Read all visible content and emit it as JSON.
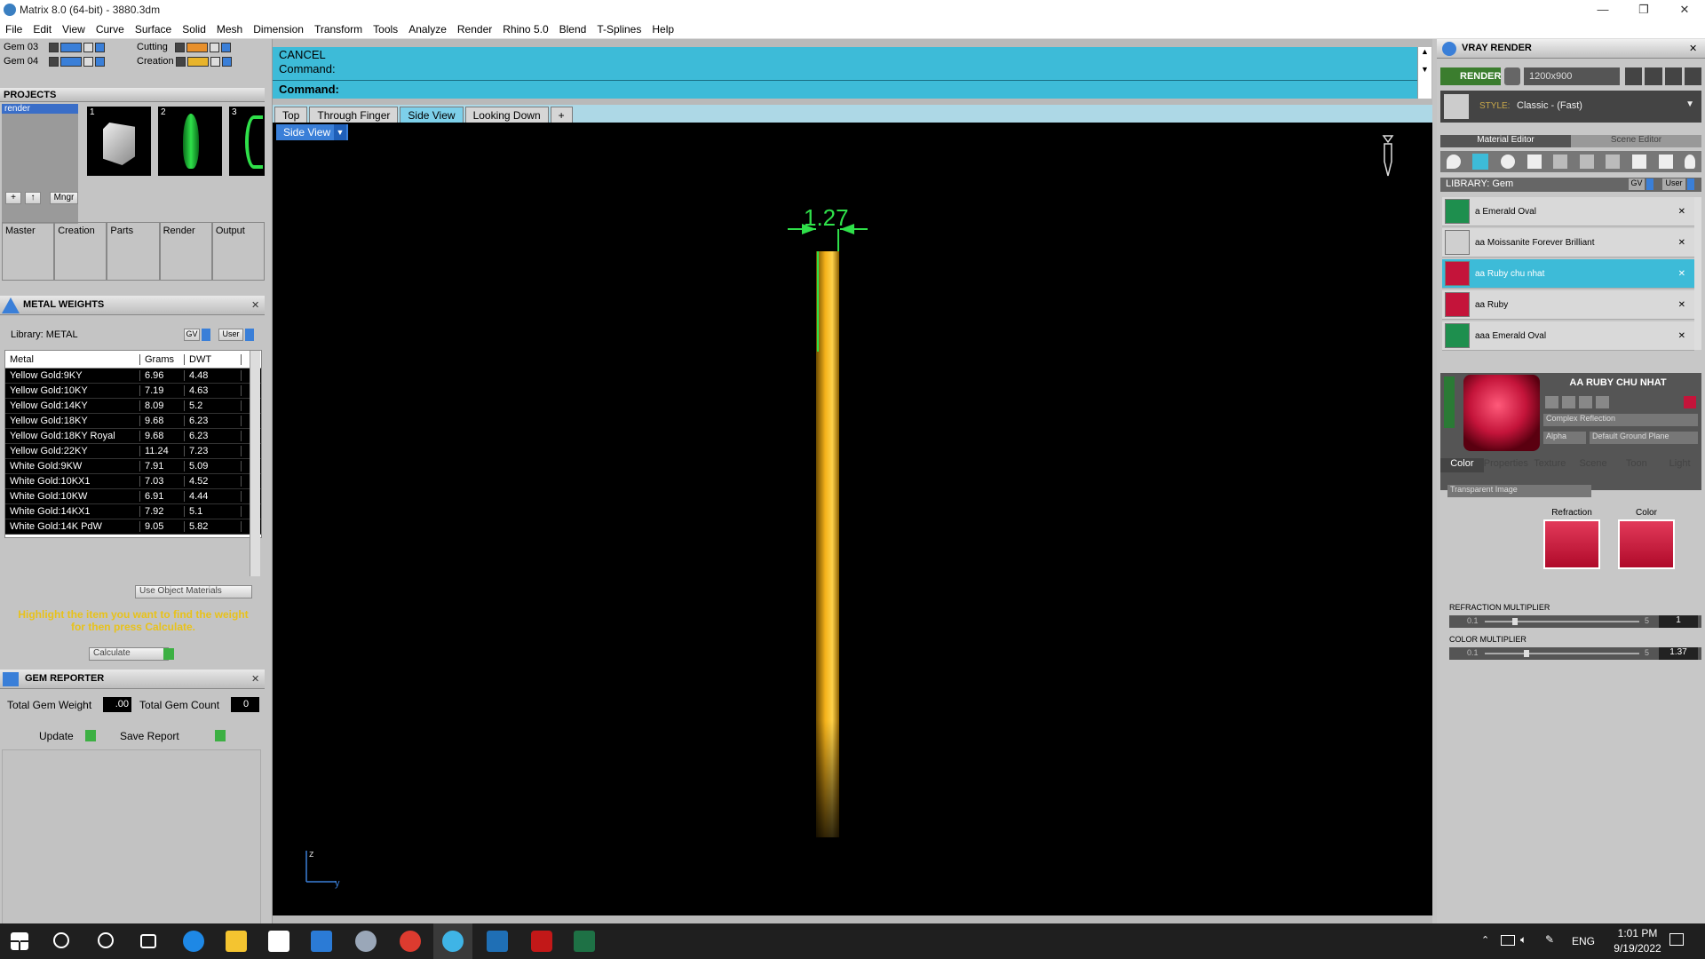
{
  "window": {
    "title": "Matrix 8.0 (64-bit) - 3880.3dm",
    "controls": [
      "—",
      "❐",
      "✕"
    ]
  },
  "menu": [
    "File",
    "Edit",
    "View",
    "Curve",
    "Surface",
    "Solid",
    "Mesh",
    "Dimension",
    "Transform",
    "Tools",
    "Analyze",
    "Render",
    "Rhino 5.0",
    "Blend",
    "T-Splines",
    "Help"
  ],
  "layers": [
    {
      "name": "Gem 03",
      "color": "#3a7fd8"
    },
    {
      "name": "Gem 04",
      "color": "#3a7fd8"
    },
    {
      "name": "Cutting",
      "color": "#e8902b"
    },
    {
      "name": "Creation",
      "color": "#e8b42b"
    }
  ],
  "projects": {
    "title": "PROJECTS",
    "item": "render",
    "thumbs": [
      "1",
      "2",
      "3"
    ],
    "mngr": "Mngr"
  },
  "panel_tabs": [
    "Master",
    "Creation",
    "Parts",
    "Render",
    "Output"
  ],
  "metal": {
    "title": "METAL WEIGHTS",
    "library": "Library: METAL",
    "gv": "GV",
    "user": "User",
    "headers": [
      "Metal",
      "Grams",
      "DWT"
    ],
    "rows": [
      [
        "Yellow Gold:9KY",
        "6.96",
        "4.48"
      ],
      [
        "Yellow Gold:10KY",
        "7.19",
        "4.63"
      ],
      [
        "Yellow Gold:14KY",
        "8.09",
        "5.2"
      ],
      [
        "Yellow Gold:18KY",
        "9.68",
        "6.23"
      ],
      [
        "Yellow Gold:18KY Royal",
        "9.68",
        "6.23"
      ],
      [
        "Yellow Gold:22KY",
        "11.24",
        "7.23"
      ],
      [
        "White Gold:9KW",
        "7.91",
        "5.09"
      ],
      [
        "White Gold:10KX1",
        "7.03",
        "4.52"
      ],
      [
        "White Gold:10KW",
        "6.91",
        "4.44"
      ],
      [
        "White Gold:14KX1",
        "7.92",
        "5.1"
      ],
      [
        "White Gold:14K PdW",
        "9.05",
        "5.82"
      ]
    ],
    "use_object": "Use Object Materials",
    "hint": "Highlight the item you want to find the weight for then press Calculate.",
    "calculate": "Calculate"
  },
  "gem": {
    "title": "GEM REPORTER",
    "total_weight_label": "Total Gem Weight",
    "total_weight": ".00",
    "total_count_label": "Total Gem Count",
    "total_count": "0",
    "update": "Update",
    "save": "Save Report"
  },
  "command": {
    "line1": "CANCEL",
    "line2": "Command:",
    "prompt": "Command:"
  },
  "tabs": [
    "Top",
    "Through Finger",
    "Side View",
    "Looking Down",
    "+"
  ],
  "active_tab": "Side View",
  "view_label": "Side View",
  "dimension": "1.27",
  "axes": {
    "z": "z",
    "y": "y"
  },
  "vray": {
    "title": "VRAY RENDER",
    "render": "RENDER",
    "resolution": "1200x900",
    "style_label": "STYLE:",
    "style": "Classic - (Fast)",
    "tabs": [
      "Material Editor",
      "Scene Editor"
    ],
    "library": "LIBRARY: Gem",
    "gv": "GV",
    "user": "User",
    "materials": [
      {
        "name": "a Emerald Oval",
        "color": "#1e8f4e"
      },
      {
        "name": "aa Moissanite Forever Brilliant",
        "color": "#cfcfcf"
      },
      {
        "name": "aa Ruby chu nhat",
        "color": "#c4143a",
        "selected": true
      },
      {
        "name": "aa Ruby",
        "color": "#c4143a"
      },
      {
        "name": "aaa Emerald Oval",
        "color": "#1e8f4e"
      }
    ],
    "selected_title": "AA RUBY CHU NHAT",
    "shader": "Complex Reflection",
    "alpha": "Alpha",
    "ground": "Default Ground Plane",
    "subtabs": [
      "Color",
      "Properties",
      "Texture",
      "Scene",
      "Toon",
      "Light"
    ],
    "transparent": "Transparent Image",
    "refraction": "Refraction",
    "color": "Color",
    "refr_mult": "REFRACTION MULTIPLIER",
    "refr_min": "0.1",
    "refr_max": "5",
    "refr_val": "1",
    "col_mult": "COLOR MULTIPLIER",
    "col_min": "0.1",
    "col_max": "5",
    "col_val": "1.37"
  },
  "tray": {
    "lang": "ENG",
    "time": "1:01 PM",
    "date": "9/19/2022"
  }
}
